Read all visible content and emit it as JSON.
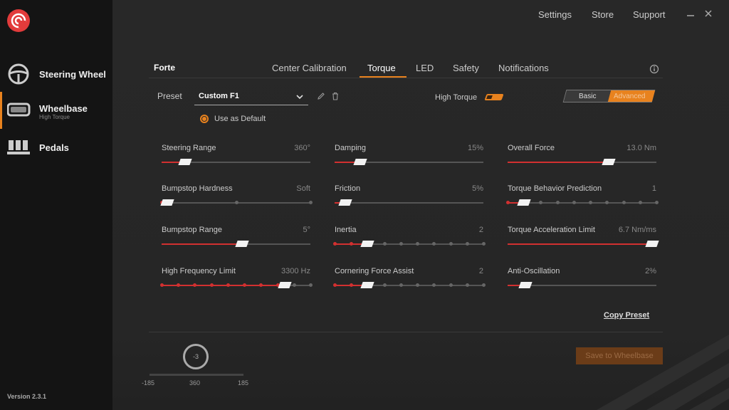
{
  "app": {
    "version": "Version 2.3.1"
  },
  "colors": {
    "accent": "#e8821e",
    "fill": "#d23030",
    "background": "#262626",
    "sidebar": "#141414"
  },
  "top_menu": {
    "settings": "Settings",
    "store": "Store",
    "support": "Support",
    "minimize_icon": "minimize-icon",
    "close_icon": "close-icon"
  },
  "sidebar": {
    "items": [
      {
        "label": "Steering Wheel",
        "sub": "",
        "icon": "steering-wheel-icon",
        "active": false
      },
      {
        "label": "Wheelbase",
        "sub": "High Torque",
        "icon": "wheelbase-icon",
        "active": true
      },
      {
        "label": "Pedals",
        "sub": "",
        "icon": "pedals-icon",
        "active": false
      }
    ]
  },
  "device": {
    "name": "Forte"
  },
  "tabs": [
    {
      "label": "Center Calibration",
      "active": false
    },
    {
      "label": "Torque",
      "active": true
    },
    {
      "label": "LED",
      "active": false
    },
    {
      "label": "Safety",
      "active": false
    },
    {
      "label": "Notifications",
      "active": false
    }
  ],
  "preset": {
    "label": "Preset",
    "value": "Custom F1",
    "use_default_label": "Use as Default",
    "use_default_checked": true
  },
  "high_torque": {
    "label": "High Torque",
    "on": true
  },
  "mode": {
    "basic": "Basic",
    "advanced": "Advanced",
    "selected": "Advanced"
  },
  "sliders": [
    {
      "label": "Steering Range",
      "value": "360°",
      "level": 0.16,
      "stepped": false
    },
    {
      "label": "Damping",
      "value": "15%",
      "level": 0.17,
      "stepped": false
    },
    {
      "label": "Overall Force",
      "value": "13.0 Nm",
      "level": 0.68,
      "stepped": false
    },
    {
      "label": "Bumpstop Hardness",
      "value": "Soft",
      "level": 0.0,
      "stepped": true,
      "steps": 3
    },
    {
      "label": "Friction",
      "value": "5%",
      "level": 0.07,
      "stepped": false
    },
    {
      "label": "Torque Behavior Prediction",
      "value": "1",
      "level": 0.11,
      "stepped": true,
      "steps": 10
    },
    {
      "label": "Bumpstop Range",
      "value": "5°",
      "level": 0.54,
      "stepped": false
    },
    {
      "label": "Inertia",
      "value": "2",
      "level": 0.22,
      "stepped": true,
      "steps": 10
    },
    {
      "label": "Torque Acceleration Limit",
      "value": "6.7 Nm/ms",
      "level": 1.0,
      "stepped": false
    },
    {
      "label": "High Frequency Limit",
      "value": "3300 Hz",
      "level": 0.83,
      "stepped": true,
      "steps": 10
    },
    {
      "label": "Cornering Force Assist",
      "value": "2",
      "level": 0.22,
      "stepped": true,
      "steps": 10
    },
    {
      "label": "Anti-Oscillation",
      "value": "2%",
      "level": 0.12,
      "stepped": false
    }
  ],
  "copy_preset": "Copy Preset",
  "rotation": {
    "value": "-3",
    "min_label": "-185",
    "mid_label": "360",
    "max_label": "185"
  },
  "save_button": "Save to Wheelbase"
}
